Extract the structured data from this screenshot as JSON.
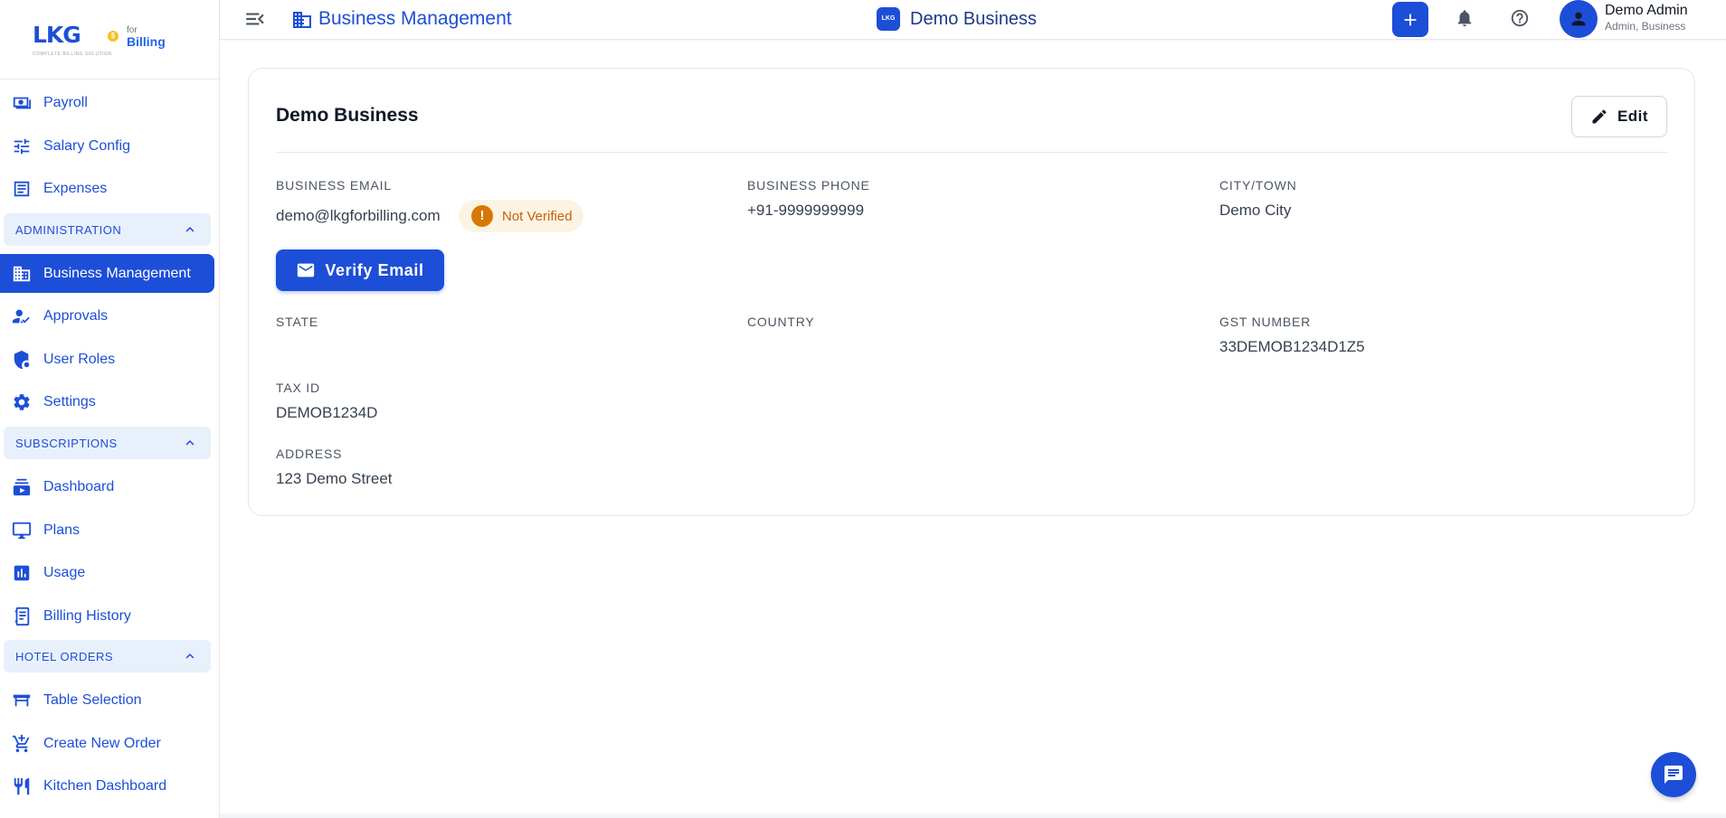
{
  "logo": {
    "brand": "LKG",
    "for": "for",
    "billing": "Billing",
    "tagline": "COMPLETE BILLING SOLUTION",
    "coin": "$"
  },
  "sidebar": {
    "items_top": [
      {
        "label": "Payroll",
        "icon": "payroll-icon"
      },
      {
        "label": "Salary Config",
        "icon": "tune-icon"
      },
      {
        "label": "Expenses",
        "icon": "receipt-icon"
      }
    ],
    "sections": {
      "administration": "ADMINISTRATION",
      "subscriptions": "SUBSCRIPTIONS",
      "hotel_orders": "HOTEL ORDERS"
    },
    "admin_items": [
      {
        "label": "Business Management",
        "icon": "building-icon"
      },
      {
        "label": "Approvals",
        "icon": "approval-icon"
      },
      {
        "label": "User Roles",
        "icon": "shield-icon"
      },
      {
        "label": "Settings",
        "icon": "gear-icon"
      }
    ],
    "sub_items": [
      {
        "label": "Dashboard",
        "icon": "dashboard-icon"
      },
      {
        "label": "Plans",
        "icon": "plans-icon"
      },
      {
        "label": "Usage",
        "icon": "usage-chart-icon"
      },
      {
        "label": "Billing History",
        "icon": "billing-history-icon"
      }
    ],
    "hotel_items": [
      {
        "label": "Table Selection",
        "icon": "table-icon"
      },
      {
        "label": "Create New Order",
        "icon": "cart-icon"
      },
      {
        "label": "Kitchen Dashboard",
        "icon": "restaurant-icon"
      }
    ]
  },
  "topbar": {
    "title": "Business Management",
    "business_badge": "LKG",
    "business_name": "Demo Business",
    "user_name": "Demo Admin",
    "user_role": "Admin, Business"
  },
  "card": {
    "title": "Demo Business",
    "edit_label": "Edit",
    "verify_label": "Verify Email",
    "status_badge": "Not Verified",
    "status_mark": "!",
    "fields": {
      "email_label": "BUSINESS EMAIL",
      "email_value": "demo@lkgforbilling.com",
      "phone_label": "BUSINESS PHONE",
      "phone_value": "+91-9999999999",
      "city_label": "CITY/TOWN",
      "city_value": "Demo City",
      "state_label": "STATE",
      "country_label": "COUNTRY",
      "gst_label": "GST NUMBER",
      "gst_value": "33DEMOB1234D1Z5",
      "tax_label": "TAX ID",
      "tax_value": "DEMOB1234D",
      "address_label": "ADDRESS",
      "address_value": "123 Demo Street"
    }
  },
  "colors": {
    "primary": "#1d4ed8",
    "section_bg": "#e8f0fb",
    "warning": "#d97706",
    "warning_bg": "#fdf3e3"
  }
}
